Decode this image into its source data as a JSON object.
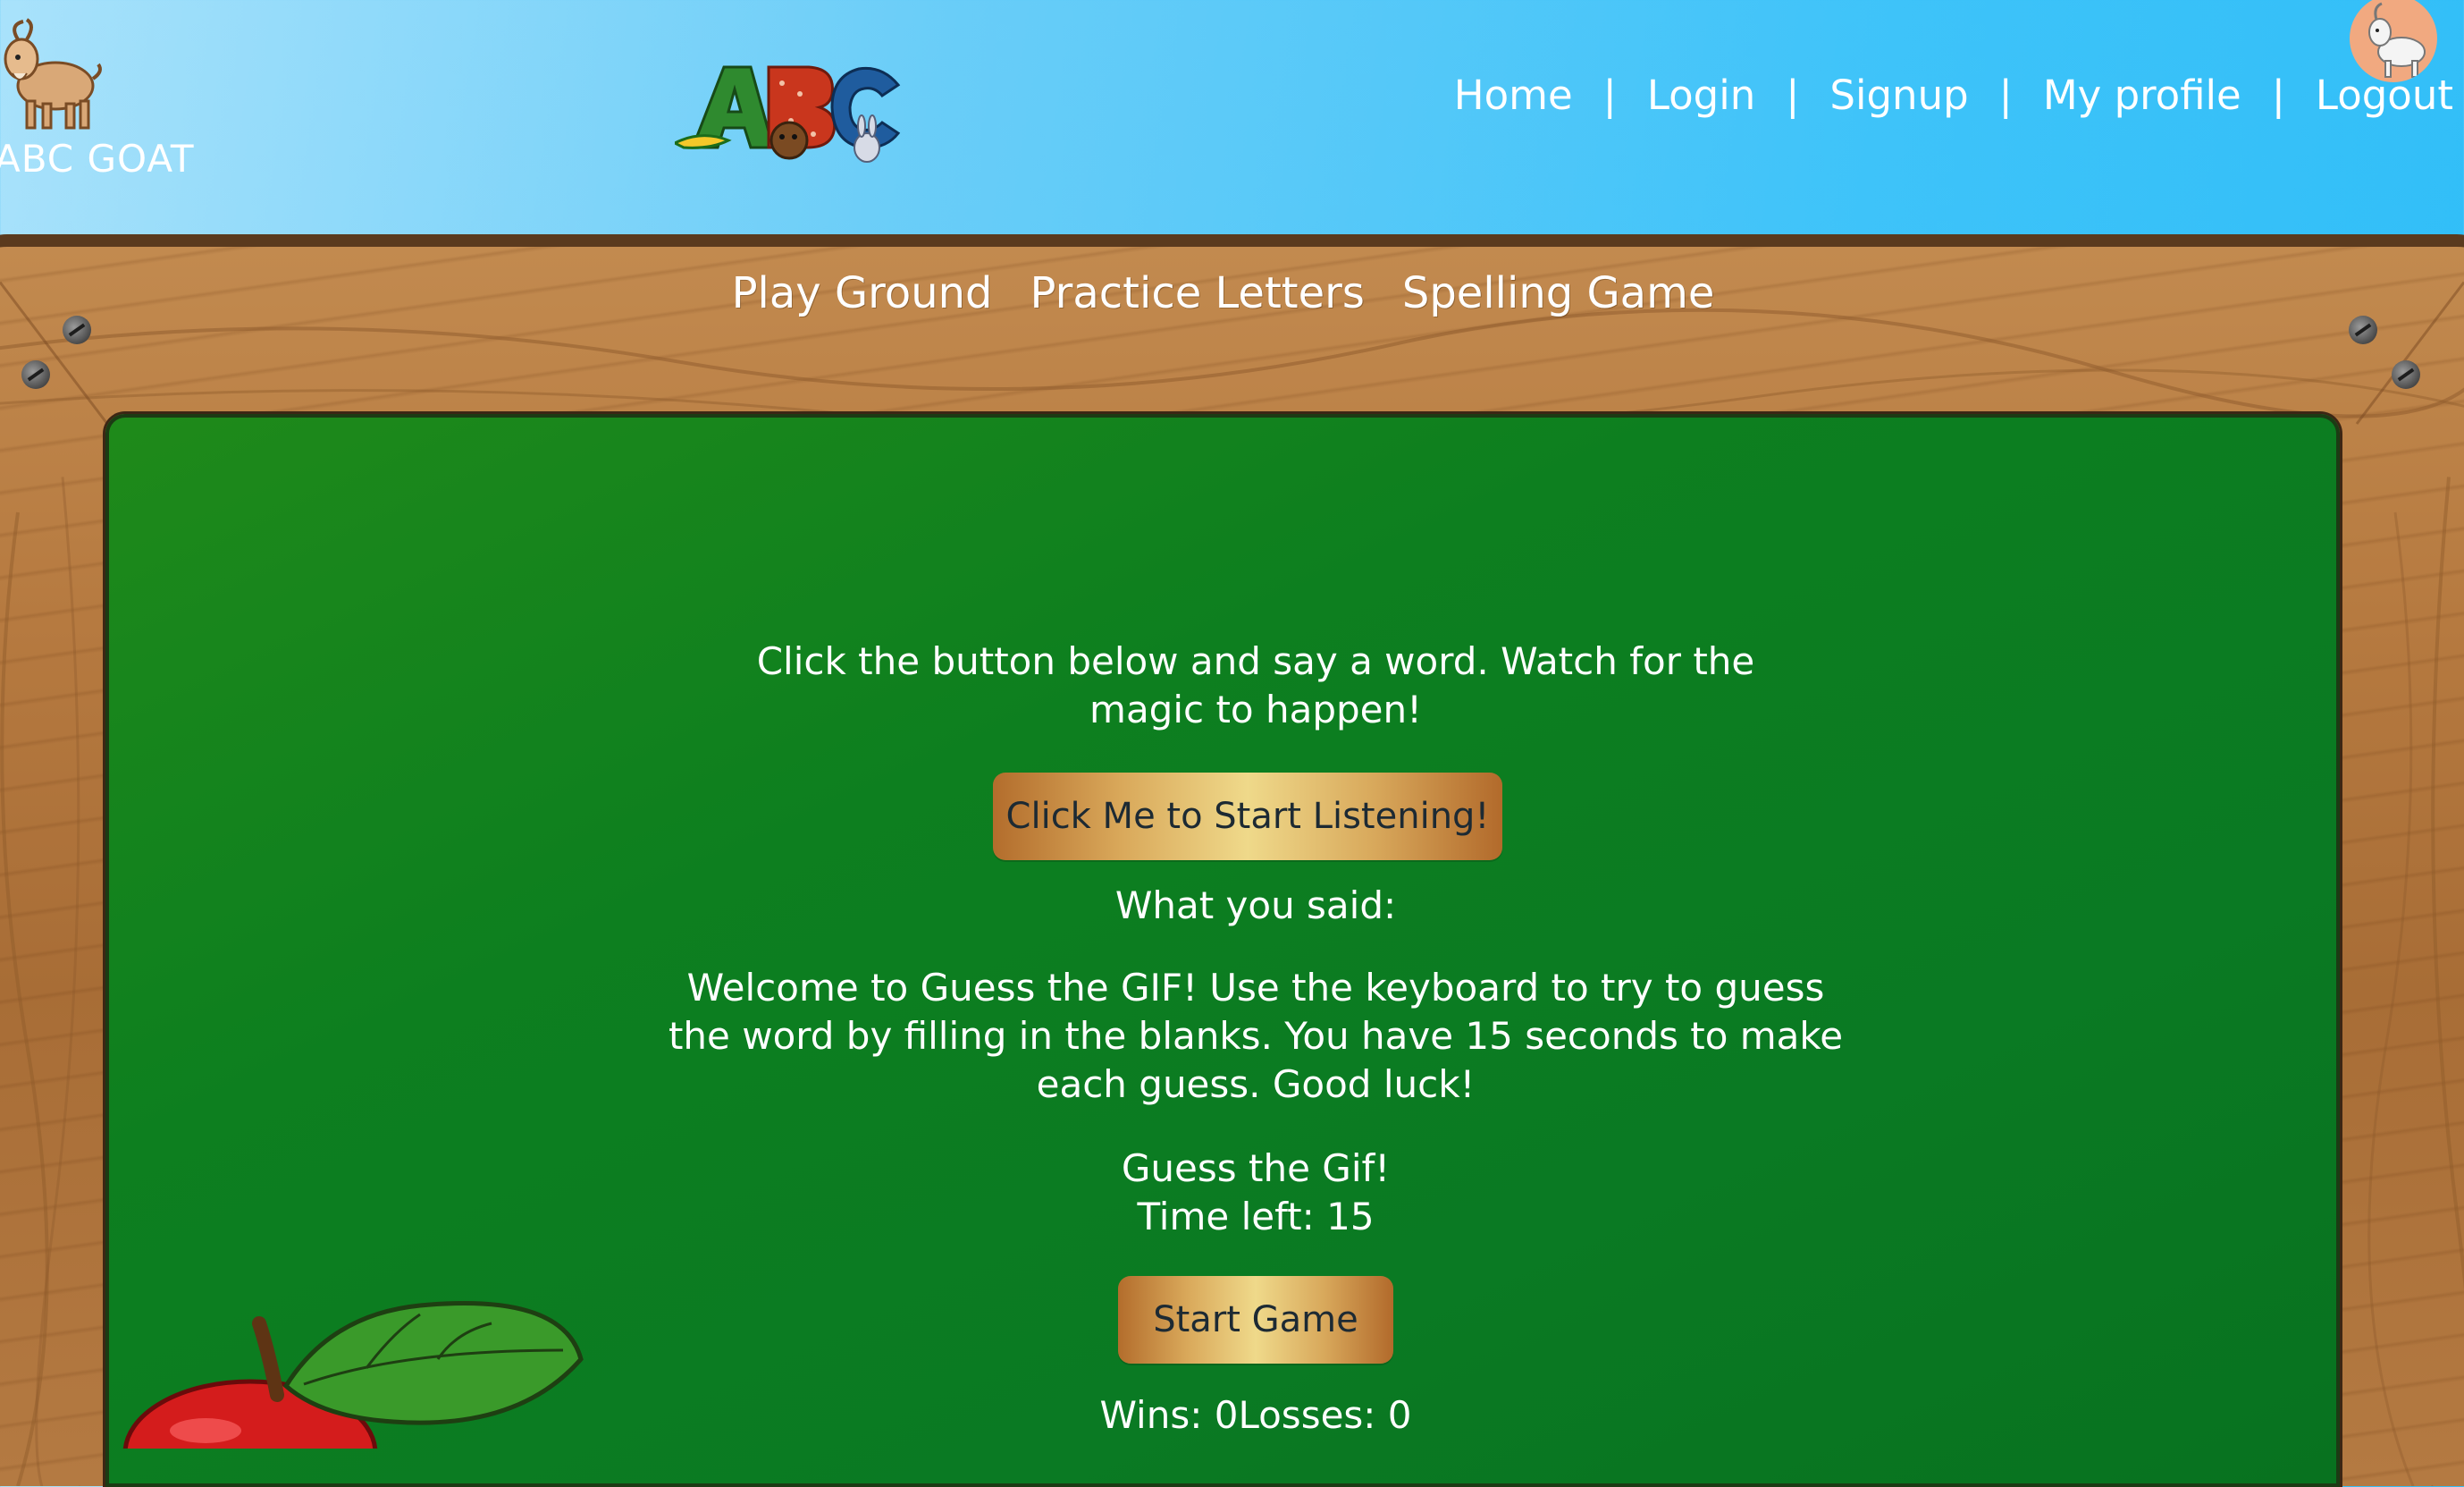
{
  "header": {
    "brand_name": "ABC GOAT",
    "nav": [
      {
        "label": "Home"
      },
      {
        "label": "Login"
      },
      {
        "label": "Signup"
      },
      {
        "label": "My profile"
      },
      {
        "label": "Logout"
      }
    ],
    "separator": "|"
  },
  "board_nav": [
    {
      "label": "Play Ground"
    },
    {
      "label": "Practice Letters"
    },
    {
      "label": "Spelling Game"
    }
  ],
  "game": {
    "intro": "Click the button below and say a word. Watch for the magic to happen!",
    "listen_button": "Click Me to Start Listening!",
    "said_label": "What you said:",
    "welcome": "Welcome to Guess the GIF! Use the keyboard to try to guess the word by filling in the blanks. You have 15 seconds to make each guess. Good luck!",
    "title": "Guess the Gif!",
    "timer": "Time left: 15",
    "start_button": "Start Game",
    "score": "Wins: 0Losses: 0"
  },
  "colors": {
    "sky": "#3ec3f9",
    "wood": "#b67a40",
    "chalkboard": "#0d7f1f",
    "button_gold": "#efd98a"
  },
  "icons": {
    "brand": "goat-logo-icon",
    "abc": "abc-animals-logo-icon",
    "avatar": "goat-avatar-icon",
    "decoration": "apple-icon"
  }
}
